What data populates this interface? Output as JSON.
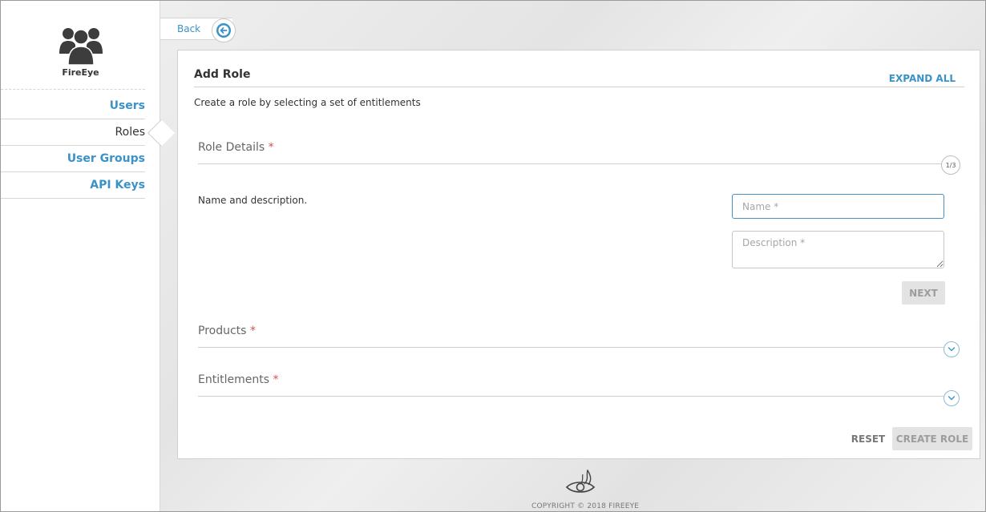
{
  "sidebar": {
    "brand": {
      "name": "FireEye",
      "icon": "user-group-icon"
    },
    "items": [
      {
        "label": "Users",
        "active": false
      },
      {
        "label": "Roles",
        "active": true
      },
      {
        "label": "User Groups",
        "active": false
      },
      {
        "label": "API Keys",
        "active": false
      }
    ]
  },
  "back": {
    "label": "Back",
    "icon": "back-arrow-icon"
  },
  "card": {
    "title": "Add Role",
    "expand_all": "EXPAND ALL",
    "subtitle": "Create a role by selecting a set of entitlements",
    "sections": {
      "role_details": {
        "title": "Role Details",
        "required_mark": "*",
        "step": "1/3",
        "description": "Name and description.",
        "name_placeholder": "Name *",
        "name_value": "",
        "description_placeholder": "Description *",
        "description_value": "",
        "next_label": "NEXT"
      },
      "products": {
        "title": "Products",
        "required_mark": "*",
        "icon": "chevron-down-icon"
      },
      "entitlements": {
        "title": "Entitlements",
        "required_mark": "*",
        "icon": "chevron-down-icon"
      }
    },
    "reset_label": "RESET",
    "create_label": "CREATE ROLE"
  },
  "footer": {
    "logo_icon": "fireeye-eye-logo",
    "copyright": "COPYRIGHT © 2018 FIREEYE"
  },
  "colors": {
    "accent": "#3a92c7",
    "required": "#d9534f",
    "disabled_button_bg": "#e3e3e3"
  }
}
